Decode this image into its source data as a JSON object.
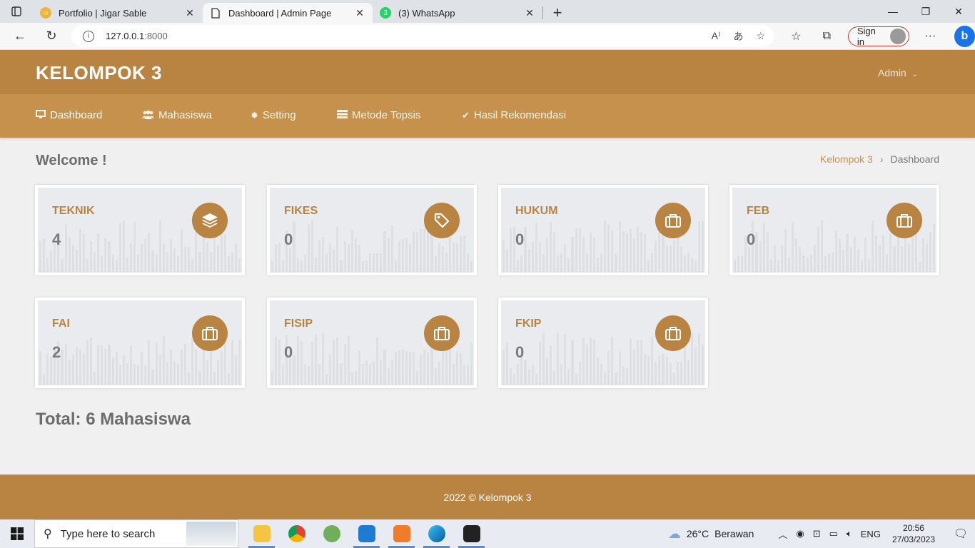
{
  "browser": {
    "tabs": [
      {
        "title": "Portfolio | Jigar Sable",
        "active": false
      },
      {
        "title": "Dashboard | Admin Page",
        "active": true
      },
      {
        "title": "(3) WhatsApp",
        "active": false
      }
    ],
    "whatsapp_badge": "3",
    "url_host": "127.0.0.1",
    "url_port": ":8000",
    "signin_label": "Sign in"
  },
  "app": {
    "brand": "KELOMPOK 3",
    "user": "Admin",
    "nav": [
      {
        "label": "Dashboard",
        "icon": "monitor-icon",
        "active": true
      },
      {
        "label": "Mahasiswa",
        "icon": "users-icon",
        "active": false
      },
      {
        "label": "Setting",
        "icon": "gear-icon",
        "active": false
      },
      {
        "label": "Metode Topsis",
        "icon": "list-icon",
        "active": false
      },
      {
        "label": "Hasil Rekomendasi",
        "icon": "check-icon",
        "active": false
      }
    ],
    "accent_color": "#b98442"
  },
  "page": {
    "welcome": "Welcome !",
    "breadcrumb": {
      "home": "Kelompok 3",
      "current": "Dashboard"
    },
    "cards": [
      {
        "label": "TEKNIK",
        "value": "4",
        "icon": "layers-icon"
      },
      {
        "label": "FIKES",
        "value": "0",
        "icon": "tag-icon"
      },
      {
        "label": "HUKUM",
        "value": "0",
        "icon": "briefcase-icon"
      },
      {
        "label": "FEB",
        "value": "0",
        "icon": "briefcase-icon"
      },
      {
        "label": "FAI",
        "value": "2",
        "icon": "briefcase-icon"
      },
      {
        "label": "FISIP",
        "value": "0",
        "icon": "briefcase-icon"
      },
      {
        "label": "FKIP",
        "value": "0",
        "icon": "briefcase-icon"
      }
    ],
    "total": "Total: 6 Mahasiswa"
  },
  "footer": {
    "text": "2022 © Kelompok 3"
  },
  "taskbar": {
    "search_placeholder": "Type here to search",
    "weather_temp": "26°C",
    "weather_text": "Berawan",
    "language": "ENG",
    "time": "20:56",
    "date": "27/03/2023"
  }
}
